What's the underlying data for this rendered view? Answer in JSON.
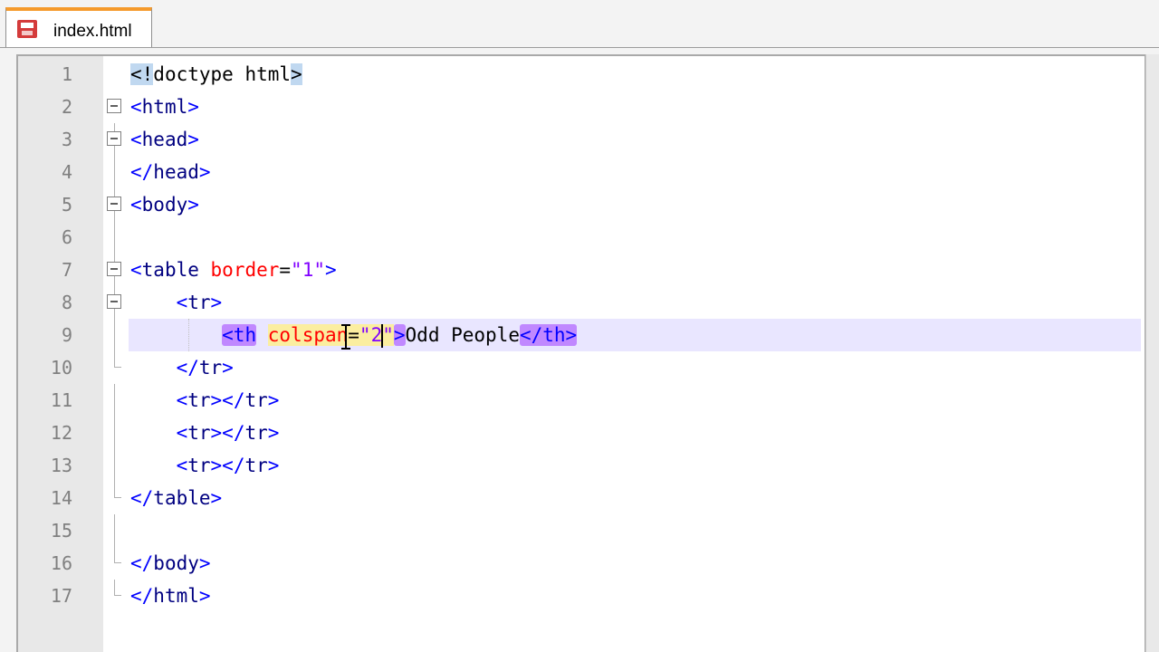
{
  "tab": {
    "label": "index.html",
    "icon": "save-file-icon"
  },
  "colors": {
    "tab_accent": "#f59a2c",
    "active_line": "#e9e6ff",
    "tag_match": "#c088ff",
    "attr_match": "#fbeea0"
  },
  "lines": [
    {
      "num": "1",
      "t1": "<!",
      "t2": "doctype html",
      "t3": ">"
    },
    {
      "num": "2",
      "lt": "<",
      "name": "html",
      "gt": ">"
    },
    {
      "num": "3",
      "lt": "<",
      "name": "head",
      "gt": ">"
    },
    {
      "num": "4",
      "lt": "</",
      "name": "head",
      "gt": ">"
    },
    {
      "num": "5",
      "lt": "<",
      "name": "body",
      "gt": ">"
    },
    {
      "num": "6"
    },
    {
      "num": "7",
      "lt": "<",
      "name": "table",
      "attr": "border",
      "eq": "=",
      "val": "\"1\"",
      "gt": ">"
    },
    {
      "num": "8",
      "lt": "<",
      "name": "tr",
      "gt": ">"
    },
    {
      "num": "9",
      "open_tag": "<th",
      "attr_a": "col",
      "attr_b": "span",
      "eq": "=",
      "val_a": "\"2",
      "val_b": "\"",
      "gt": ">",
      "text": "Odd People",
      "close_tag": "</th>"
    },
    {
      "num": "10",
      "lt": "</",
      "name": "tr",
      "gt": ">"
    },
    {
      "num": "11",
      "a": "<",
      "b": "tr",
      "c": "></",
      "d": "tr",
      "e": ">"
    },
    {
      "num": "12",
      "a": "<",
      "b": "tr",
      "c": "></",
      "d": "tr",
      "e": ">"
    },
    {
      "num": "13",
      "a": "<",
      "b": "tr",
      "c": "></",
      "d": "tr",
      "e": ">"
    },
    {
      "num": "14",
      "lt": "</",
      "name": "table",
      "gt": ">"
    },
    {
      "num": "15"
    },
    {
      "num": "16",
      "lt": "</",
      "name": "body",
      "gt": ">"
    },
    {
      "num": "17",
      "lt": "</",
      "name": "html",
      "gt": ">"
    }
  ]
}
